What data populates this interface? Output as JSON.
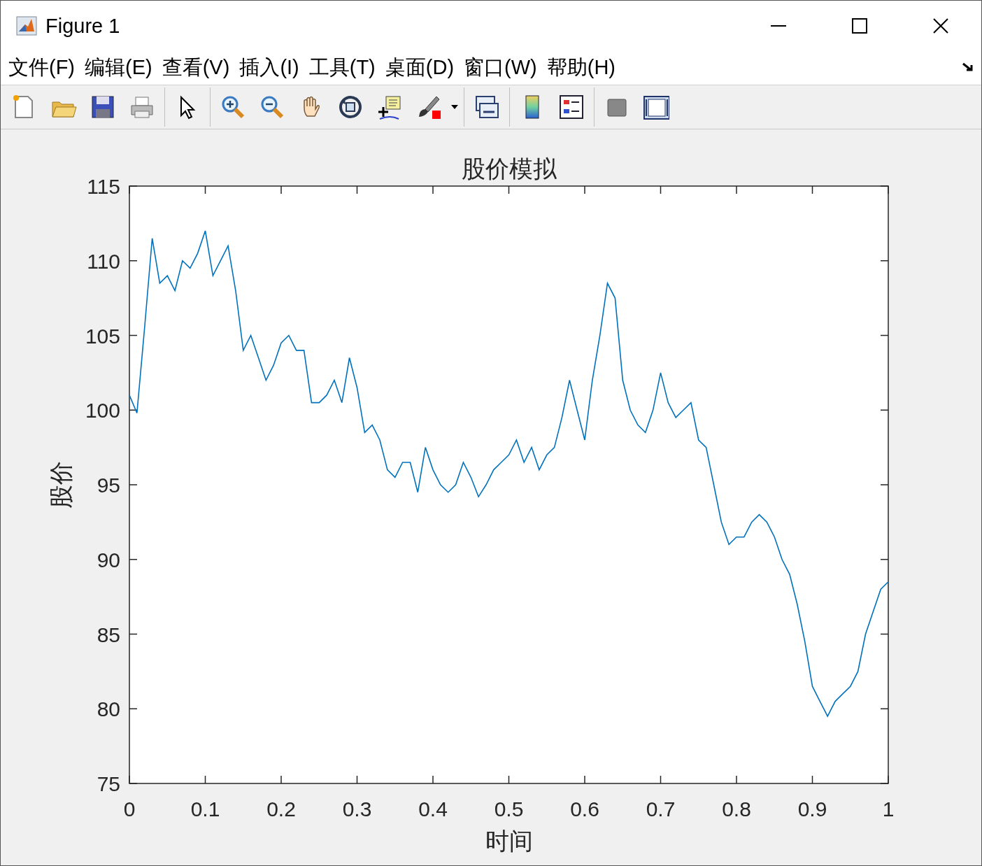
{
  "window": {
    "title": "Figure 1"
  },
  "menu": [
    {
      "label": "文件(F)"
    },
    {
      "label": "编辑(E)"
    },
    {
      "label": "查看(V)"
    },
    {
      "label": "插入(I)"
    },
    {
      "label": "工具(T)"
    },
    {
      "label": "桌面(D)"
    },
    {
      "label": "窗口(W)"
    },
    {
      "label": "帮助(H)"
    }
  ],
  "axes": {
    "chart_data": {
      "type": "line",
      "title": "股价模拟",
      "xlabel": "时间",
      "ylabel": "股价",
      "xlim": [
        0,
        1
      ],
      "ylim": [
        75,
        115
      ],
      "xticks": [
        {
          "value": 0,
          "label": "0"
        },
        {
          "value": 0.1,
          "label": "0.1"
        },
        {
          "value": 0.2,
          "label": "0.2"
        },
        {
          "value": 0.3,
          "label": "0.3"
        },
        {
          "value": 0.4,
          "label": "0.4"
        },
        {
          "value": 0.5,
          "label": "0.5"
        },
        {
          "value": 0.6,
          "label": "0.6"
        },
        {
          "value": 0.7,
          "label": "0.7"
        },
        {
          "value": 0.8,
          "label": "0.8"
        },
        {
          "value": 0.9,
          "label": "0.9"
        },
        {
          "value": 1,
          "label": "1"
        }
      ],
      "yticks": [
        {
          "value": 75,
          "label": "75"
        },
        {
          "value": 80,
          "label": "80"
        },
        {
          "value": 85,
          "label": "85"
        },
        {
          "value": 90,
          "label": "90"
        },
        {
          "value": 95,
          "label": "95"
        },
        {
          "value": 100,
          "label": "100"
        },
        {
          "value": 105,
          "label": "105"
        },
        {
          "value": 110,
          "label": "110"
        },
        {
          "value": 115,
          "label": "115"
        }
      ],
      "x": [
        0,
        0.01,
        0.02,
        0.03,
        0.04,
        0.05,
        0.06,
        0.07,
        0.08,
        0.09,
        0.1,
        0.11,
        0.12,
        0.13,
        0.14,
        0.15,
        0.16,
        0.17,
        0.18,
        0.19,
        0.2,
        0.21,
        0.22,
        0.23,
        0.24,
        0.25,
        0.26,
        0.27,
        0.28,
        0.29,
        0.3,
        0.31,
        0.32,
        0.33,
        0.34,
        0.35,
        0.36,
        0.37,
        0.38,
        0.39,
        0.4,
        0.41,
        0.42,
        0.43,
        0.44,
        0.45,
        0.46,
        0.47,
        0.48,
        0.49,
        0.5,
        0.51,
        0.52,
        0.53,
        0.54,
        0.55,
        0.56,
        0.57,
        0.58,
        0.59,
        0.6,
        0.61,
        0.62,
        0.63,
        0.64,
        0.65,
        0.66,
        0.67,
        0.68,
        0.69,
        0.7,
        0.71,
        0.72,
        0.73,
        0.74,
        0.75,
        0.76,
        0.77,
        0.78,
        0.79,
        0.8,
        0.81,
        0.82,
        0.83,
        0.84,
        0.85,
        0.86,
        0.87,
        0.88,
        0.89,
        0.9,
        0.91,
        0.92,
        0.93,
        0.94,
        0.95,
        0.96,
        0.97,
        0.98,
        0.99,
        1
      ],
      "values": [
        101,
        99.8,
        105.5,
        111.5,
        108.5,
        109,
        108,
        110,
        109.5,
        110.5,
        112,
        109,
        110,
        111,
        108,
        104,
        105,
        103.5,
        102,
        103,
        104.5,
        105,
        104,
        104,
        100.5,
        100.5,
        101,
        102,
        100.5,
        103.5,
        101.5,
        98.5,
        99,
        98,
        96,
        95.5,
        96.5,
        96.5,
        94.5,
        97.5,
        96,
        95,
        94.5,
        95,
        96.5,
        95.5,
        94.2,
        95,
        96,
        96.5,
        97,
        98,
        96.5,
        97.5,
        96,
        97,
        97.5,
        99.5,
        102,
        100,
        98,
        102,
        105,
        108.5,
        107.5,
        102,
        100,
        99,
        98.5,
        100,
        102.5,
        100.5,
        99.5,
        100,
        100.5,
        98,
        97.5,
        95,
        92.5,
        91,
        91.5,
        91.5,
        92.5,
        93,
        92.5,
        91.5,
        90,
        89,
        87,
        84.5,
        81.5,
        80.5,
        79.5,
        80.5,
        81,
        81.5,
        82.5,
        85,
        86.5,
        88,
        88.5
      ]
    }
  }
}
